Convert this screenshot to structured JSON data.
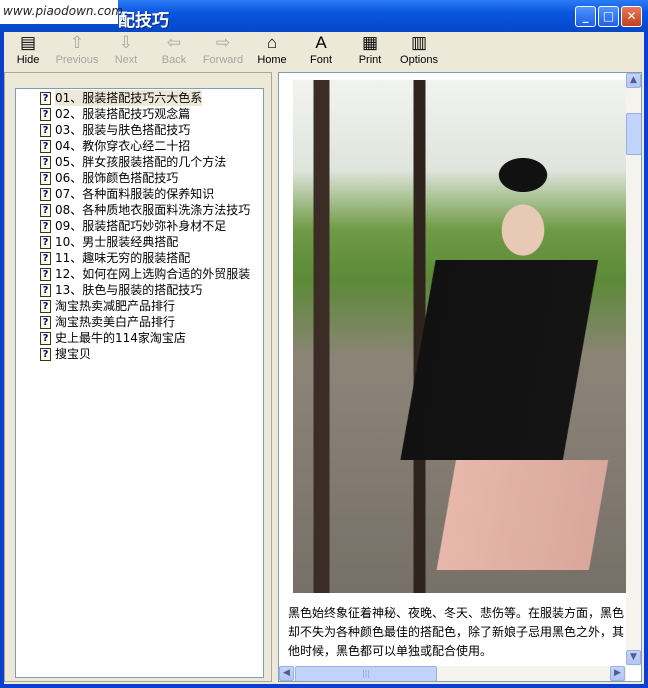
{
  "window": {
    "title": "配技巧",
    "watermark": "www.piaodown.com",
    "controls": [
      "minimize",
      "maximize",
      "close"
    ]
  },
  "toolbar": [
    {
      "label": "Hide",
      "icon": "hide-icon",
      "enabled": true
    },
    {
      "label": "Previous",
      "icon": "arrow-up-icon",
      "enabled": false
    },
    {
      "label": "Next",
      "icon": "arrow-down-icon",
      "enabled": false
    },
    {
      "label": "Back",
      "icon": "arrow-left-icon",
      "enabled": false
    },
    {
      "label": "Forward",
      "icon": "arrow-right-icon",
      "enabled": false
    },
    {
      "label": "Home",
      "icon": "home-icon",
      "enabled": true
    },
    {
      "label": "Font",
      "icon": "font-icon",
      "enabled": true
    },
    {
      "label": "Print",
      "icon": "printer-icon",
      "enabled": true
    },
    {
      "label": "Options",
      "icon": "options-icon",
      "enabled": true
    }
  ],
  "toc": [
    "01、服装搭配技巧六大色系",
    "02、服装搭配技巧观念篇",
    "03、服装与肤色搭配技巧",
    "04、教你穿衣心经二十招",
    "05、胖女孩服装搭配的几个方法",
    "06、服饰颜色搭配技巧",
    "07、各种面料服装的保养知识",
    "08、各种质地衣服面料洗涤方法技巧",
    "09、服装搭配巧妙弥补身材不足",
    "10、男士服装经典搭配",
    "11、趣味无穷的服装搭配",
    "12、如何在网上选购合适的外贸服装",
    "13、肤色与服装的搭配技巧",
    "淘宝热卖减肥产品排行",
    "淘宝热卖美白产品排行",
    "史上最牛的114家淘宝店",
    "搜宝贝"
  ],
  "content": {
    "paragraph": "黑色始终象征着神秘、夜晚、冬天、悲伤等。在服装方面，黑色却不失为各种颜色最佳的搭配色，除了新娘子忌用黑色之外，其他时候，黑色都可以单独或配合使用。"
  }
}
